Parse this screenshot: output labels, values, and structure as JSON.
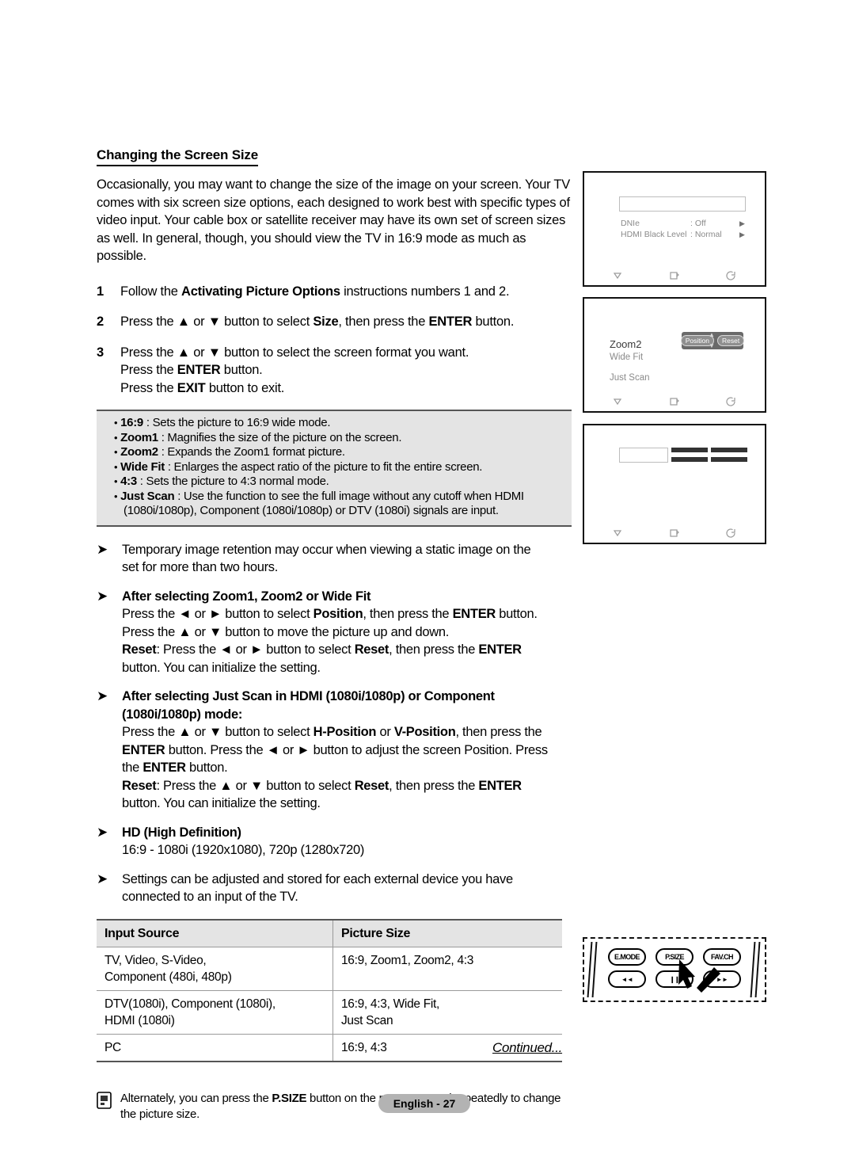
{
  "document": {
    "heading": "Changing the Screen Size",
    "intro": "Occasionally, you may want to change the size of the image on your screen. Your TV comes with six screen size options, each designed to work best with specific types of video input. Your cable box or satellite receiver may have its own set of screen sizes as well. In general, though, you should view the TV in 16:9 mode as much as possible.",
    "steps": [
      {
        "num": "1",
        "lines": [
          "Follow the <b>Activating Picture Options</b> instructions numbers 1 and 2."
        ]
      },
      {
        "num": "2",
        "lines": [
          "Press the ▲ or ▼ button to select <b>Size</b>, then press the <b>ENTER</b> button."
        ]
      },
      {
        "num": "3",
        "lines": [
          "Press the ▲ or ▼ button to select the screen format you want.",
          "Press the <b>ENTER</b> button.",
          "Press the <b>EXIT</b> button to exit."
        ]
      }
    ],
    "size_options": [
      {
        "name": "16:9",
        "desc": ": Sets the picture to 16:9 wide mode."
      },
      {
        "name": "Zoom1",
        "desc": ": Magnifies the size of the picture on the screen."
      },
      {
        "name": "Zoom2",
        "desc": ": Expands the Zoom1 format picture."
      },
      {
        "name": "Wide Fit",
        "desc": ": Enlarges the aspect ratio of the picture to fit the entire screen."
      },
      {
        "name": "4:3",
        "desc": ": Sets the picture to 4:3 normal mode."
      },
      {
        "name": "Just Scan",
        "desc": ": Use the function to see the full image without any cutoff when HDMI",
        "cont": "(1080i/1080p), Component (1080i/1080p) or DTV (1080i) signals are input."
      }
    ],
    "notes": [
      {
        "heading": "",
        "lines": [
          "Temporary image retention may occur when viewing a static image on the",
          "set for more than two hours."
        ]
      },
      {
        "heading": "After selecting Zoom1, Zoom2 or Wide Fit",
        "lines": [
          "Press the ◄ or ► button to select <b>Position</b>, then press the <b>ENTER</b> button.",
          "Press the ▲ or ▼ button to move the picture up and down.",
          "<b>Reset</b>: Press the ◄ or ► button to select <b>Reset</b>, then press the <b>ENTER</b>",
          "button. You can initialize the setting."
        ]
      },
      {
        "heading": "After selecting Just Scan in HDMI (1080i/1080p) or Component",
        "heading2": "(1080i/1080p) mode:",
        "lines": [
          "Press the ▲ or ▼ button to select <b>H-Position</b> or <b>V-Position</b>, then press the",
          "<b>ENTER</b> button. Press the ◄ or ► button to adjust the screen Position. Press",
          "the <b>ENTER</b> button.",
          "<b>Reset</b>: Press the ▲ or ▼ button to select <b>Reset</b>, then press the <b>ENTER</b>",
          "button. You can initialize the setting."
        ]
      },
      {
        "heading": "HD (High Definition)",
        "lines": [
          "16:9 - 1080i (1920x1080), 720p (1280x720)"
        ]
      },
      {
        "heading": "",
        "lines": [
          "Settings can be adjusted and stored for each external device you have",
          "connected to an input of the TV."
        ]
      }
    ],
    "table": {
      "headers": [
        "Input Source",
        "Picture Size"
      ],
      "rows": [
        {
          "source": [
            "TV, Video, S-Video,",
            "Component (480i, 480p)"
          ],
          "size": [
            "16:9, Zoom1, Zoom2, 4:3"
          ]
        },
        {
          "source": [
            "DTV(1080i), Component (1080i),",
            "HDMI (1080i)"
          ],
          "size": [
            "16:9, 4:3, Wide Fit,",
            "Just Scan"
          ]
        },
        {
          "source": [
            "PC"
          ],
          "size": [
            "16:9, 4:3"
          ]
        }
      ]
    },
    "bottom_note": {
      "line1_pre": "Alternately, you can press the ",
      "line1_bold": "P.SIZE",
      "line1_post": " button on the remote control repeatedly to change",
      "line2": "the picture size."
    },
    "continued": "Continued...",
    "page_label": "English - 27"
  },
  "panels": {
    "panel1": {
      "rows": [
        {
          "label": "DNIe",
          "value": ": Off"
        },
        {
          "label": "HDMI Black Level",
          "value": ": Normal"
        }
      ],
      "footer": [
        "move-icon",
        "enter-icon",
        "return-icon"
      ]
    },
    "panel2": {
      "items": [
        "Zoom2",
        "Wide Fit",
        "Just Scan"
      ],
      "position_label": "Position",
      "reset_label": "Reset",
      "footer": [
        "move-icon",
        "enter-icon",
        "return-icon"
      ]
    },
    "panel3": {
      "footer": [
        "move-icon",
        "enter-icon",
        "return-icon"
      ]
    }
  },
  "remote": {
    "buttons_top": [
      "E.MODE",
      "P.SIZE",
      "FAV.CH"
    ],
    "buttons_bottom": [
      "◄◄",
      "❙❙",
      "►►"
    ]
  },
  "colors": {
    "grey_box": "#e4e4e4",
    "table_header": "#e4e4e4",
    "page_tag": "#b3b3b3",
    "osd_text": "#8a8a8a"
  }
}
